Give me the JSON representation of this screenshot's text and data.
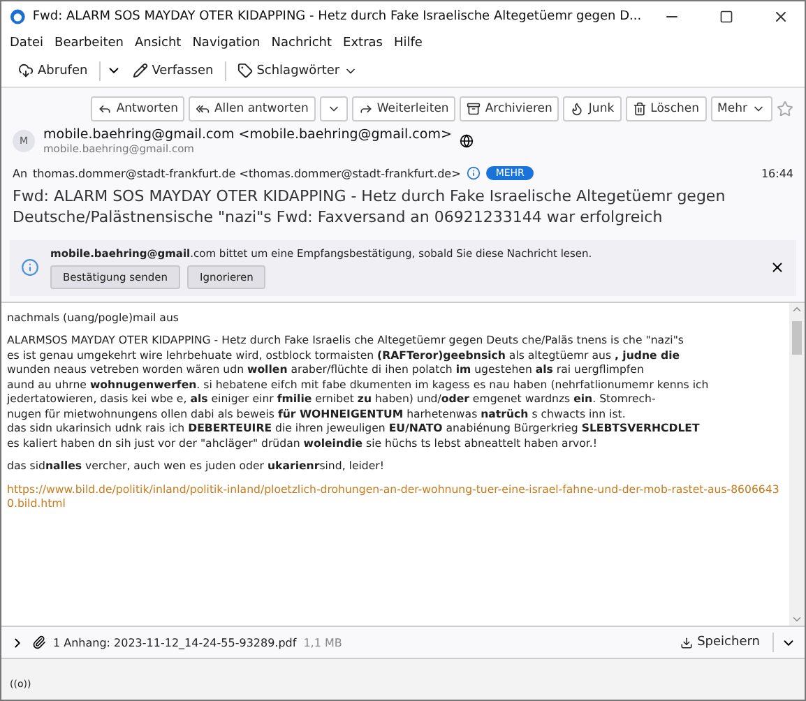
{
  "window": {
    "title": "Fwd: ALARM SOS MAYDAY OTER KIDAPPING - Hetz durch Fake Israelische Altegetüemr gegen D..."
  },
  "menu": [
    "Datei",
    "Bearbeiten",
    "Ansicht",
    "Navigation",
    "Nachricht",
    "Extras",
    "Hilfe"
  ],
  "toolbar": [
    {
      "kind": "split",
      "label": "Abrufen"
    },
    {
      "kind": "plain",
      "label": "Verfassen"
    },
    {
      "kind": "dropdown",
      "label": "Schlagwörter"
    }
  ],
  "actions": [
    {
      "kind": "plain",
      "label": "Antworten"
    },
    {
      "kind": "split",
      "label": "Allen antworten"
    },
    {
      "kind": "plain",
      "label": "Weiterleiten"
    },
    {
      "kind": "plain",
      "label": "Archivieren"
    },
    {
      "kind": "plain",
      "label": "Junk"
    },
    {
      "kind": "plain",
      "label": "Löschen"
    },
    {
      "kind": "dropdown",
      "label": "Mehr"
    }
  ],
  "sender": {
    "avatar": "M",
    "name": "mobile.baehring@gmail.com <mobile.baehring@gmail.com>",
    "address": "mobile.baehring@gmail.com"
  },
  "recipient": {
    "label": "An",
    "value": "thomas.dommer@stadt-frankfurt.de <thomas.dommer@stadt-frankfurt.de>",
    "more": "MEHR",
    "time": "16:44"
  },
  "subject": "Fwd: ALARM SOS MAYDAY OTER KIDAPPING - Hetz durch Fake Israelische Altegetüemr gegen Deutsche/Palästnensische \"nazi\"s Fwd: Faxversand an 06921233144 war erfolgreich",
  "notice": {
    "text": "**mobile.baehring@gmail**.com bittet um eine Empfangsbestätigung, sobald Sie diese Nachricht lesen.",
    "buttons": [
      "Bestätigung senden",
      "Ignorieren"
    ]
  },
  "body": {
    "paragraphs": [
      [
        "nachmals (uang/pogle)mail aus"
      ],
      [
        "ALARMSOS MAYDAY OTER KIDAPPING - Hetz durch Fake Israelis che Altegetüemr gegen Deuts che/Paläs tnens is che \"nazi\"s",
        "es ist genau umgekehrt wire lehrbehuate wird, ostblock tormaisten **(RAFTeror)geebnsich** als altegtüemr aus **, judne die**",
        "wunden neaus vetreben worden wären udn **wollen** araber/flüchte di ihen polatch **im** ugestehen **als** rai uergflimpfen",
        "aund au uhrne **wohnugenwerfen**. si hebatene eifch mit fabe dkumenten im kagess es nau haben (nehrfatlionumemr kenns ich",
        "jedertatowieren, dasis kei wbe e, **als** einiger einr **fmilie** ernibet **zu** haben) und/**oder** emgenet wardnzs **ein**. Stomrech-",
        "nugen für mietwohnungens ollen dabi als beweis **für WOHNEIGENTUM** harhetenwas **natrüch** s chwacts inn ist.",
        "das sidn ukarinsich udnk rais ich **DEBERTEUIRE** die ihren jeweuligen **EU/NATO** anabiénung Bürgerkrieg **SLEBTSVERHCDLET**",
        "es kaliert haben dn sih just vor der \"ahcläger\" drüdan **woleindie** sie hüchs ts lebst abneattelt haben arvor.!"
      ],
      [
        "das sid**nalles** vercher, auch wen es juden oder **ukarienr**sind, leider!"
      ]
    ],
    "link": "https://www.bild.de/politik/inland/politik-inland/ploetzlich-drohungen-an-der-wohnung-tuer-eine-israel-fahne-und-der-mob-rastet-aus-86066430.bild.html"
  },
  "attachment": {
    "expanded": false,
    "label": "1 Anhang: 2023-11-12_14-24-55-93289.pdf",
    "size": "1,1 MB",
    "save": "Speichern"
  },
  "status_bar": {
    "icon_text": "((o))"
  }
}
